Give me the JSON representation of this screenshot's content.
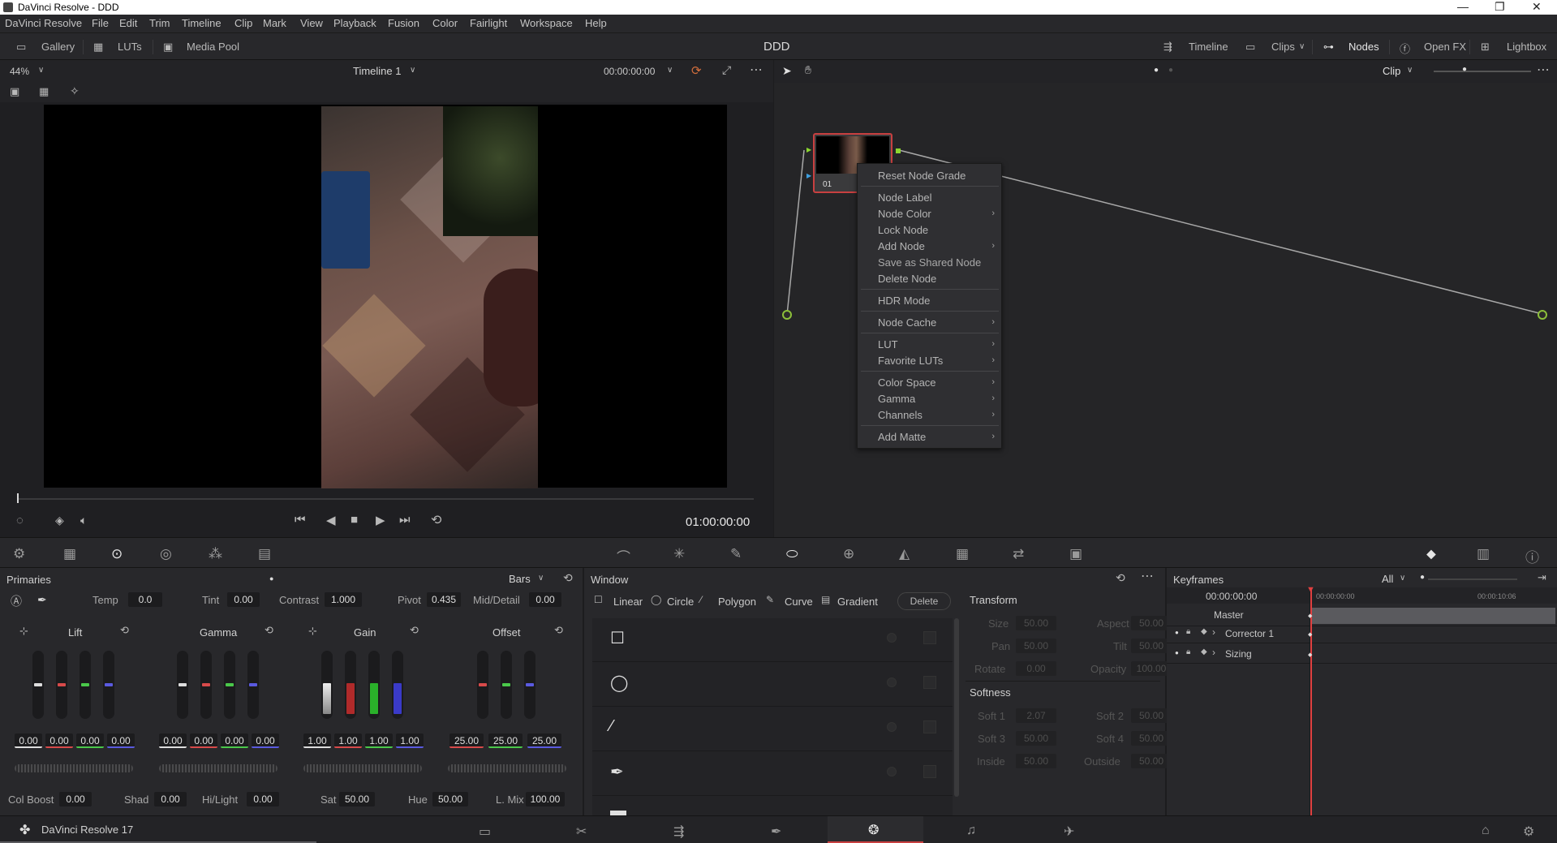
{
  "title_bar": {
    "title": "DaVinci Resolve - DDD"
  },
  "menu": [
    "DaVinci Resolve",
    "File",
    "Edit",
    "Trim",
    "Timeline",
    "Clip",
    "Mark",
    "View",
    "Playback",
    "Fusion",
    "Color",
    "Fairlight",
    "Workspace",
    "Help"
  ],
  "toolbar": {
    "gallery": "Gallery",
    "luts": "LUTs",
    "media_pool": "Media Pool",
    "project": "DDD",
    "timeline": "Timeline",
    "clips": "Clips",
    "nodes": "Nodes",
    "open_fx": "Open FX",
    "lightbox": "Lightbox"
  },
  "viewer": {
    "zoom": "44%",
    "timeline_name": "Timeline 1",
    "timecode": "00:00:00:00",
    "playhead_tc": "01:00:00:00"
  },
  "node_editor": {
    "mode": "Clip",
    "node_label": "01"
  },
  "context_menu": {
    "items": [
      {
        "label": "Reset Node Grade",
        "submenu": false
      },
      {
        "label": "Node Label",
        "submenu": false
      },
      {
        "label": "Node Color",
        "submenu": true
      },
      {
        "label": "Lock Node",
        "submenu": false
      },
      {
        "label": "Add Node",
        "submenu": true
      },
      {
        "label": "Save as Shared Node",
        "submenu": false
      },
      {
        "label": "Delete Node",
        "submenu": false
      },
      {
        "label": "HDR Mode",
        "submenu": false
      },
      {
        "label": "Node Cache",
        "submenu": true
      },
      {
        "label": "LUT",
        "submenu": true
      },
      {
        "label": "Favorite LUTs",
        "submenu": true
      },
      {
        "label": "Color Space",
        "submenu": true
      },
      {
        "label": "Gamma",
        "submenu": true
      },
      {
        "label": "Channels",
        "submenu": true
      },
      {
        "label": "Add Matte",
        "submenu": true
      }
    ]
  },
  "primaries": {
    "title": "Primaries",
    "mode": "Bars",
    "temp_label": "Temp",
    "temp": "0.0",
    "tint_label": "Tint",
    "tint": "0.00",
    "contrast_label": "Contrast",
    "contrast": "1.000",
    "pivot_label": "Pivot",
    "pivot": "0.435",
    "middetail_label": "Mid/Detail",
    "middetail": "0.00",
    "lift": {
      "label": "Lift",
      "values": [
        "0.00",
        "0.00",
        "0.00",
        "0.00"
      ]
    },
    "gamma": {
      "label": "Gamma",
      "values": [
        "0.00",
        "0.00",
        "0.00",
        "0.00"
      ]
    },
    "gain": {
      "label": "Gain",
      "values": [
        "1.00",
        "1.00",
        "1.00",
        "1.00"
      ]
    },
    "offset": {
      "label": "Offset",
      "values": [
        "25.00",
        "25.00",
        "25.00"
      ]
    },
    "colboost_label": "Col Boost",
    "colboost": "0.00",
    "shad_label": "Shad",
    "shad": "0.00",
    "hilight_label": "Hi/Light",
    "hilight": "0.00",
    "sat_label": "Sat",
    "sat": "50.00",
    "hue_label": "Hue",
    "hue": "50.00",
    "lmix_label": "L. Mix",
    "lmix": "100.00"
  },
  "window_panel": {
    "title": "Window",
    "linear": "Linear",
    "circle": "Circle",
    "polygon": "Polygon",
    "curve": "Curve",
    "gradient": "Gradient",
    "delete": "Delete",
    "transform": "Transform",
    "size": "Size",
    "size_v": "50.00",
    "aspect": "Aspect",
    "aspect_v": "50.00",
    "pan": "Pan",
    "pan_v": "50.00",
    "tilt": "Tilt",
    "tilt_v": "50.00",
    "rotate": "Rotate",
    "rotate_v": "0.00",
    "opacity": "Opacity",
    "opacity_v": "100.00",
    "softness": "Softness",
    "soft1": "Soft 1",
    "soft1_v": "2.07",
    "soft2": "Soft 2",
    "soft2_v": "50.00",
    "soft3": "Soft 3",
    "soft3_v": "50.00",
    "soft4": "Soft 4",
    "soft4_v": "50.00",
    "inside": "Inside",
    "inside_v": "50.00",
    "outside": "Outside",
    "outside_v": "50.00"
  },
  "keyframes": {
    "title": "Keyframes",
    "filter": "All",
    "timecode": "00:00:00:00",
    "ruler_start": "00:00:00:00",
    "ruler_end": "00:00:10:06",
    "master": "Master",
    "tracks": [
      "Corrector 1",
      "Sizing"
    ]
  },
  "bottom": {
    "app": "DaVinci Resolve 17"
  }
}
